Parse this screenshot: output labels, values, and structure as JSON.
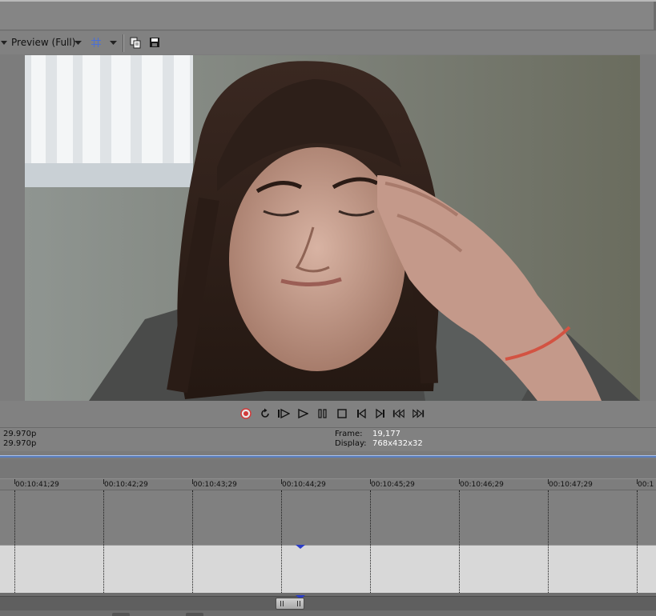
{
  "toolbar": {
    "preview_quality": "Preview (Full)",
    "icons": [
      "dropdown-caret",
      "grid-overlay-icon",
      "copy-snapshot-icon",
      "save-snapshot-icon"
    ]
  },
  "transport": {
    "buttons": [
      "record",
      "loop",
      "play-from-start",
      "play",
      "pause",
      "stop",
      "previous-frame",
      "next-frame",
      "go-to-start",
      "go-to-end"
    ]
  },
  "info": {
    "project_rate": "29.970p",
    "preview_rate": "29.970p",
    "frame_label": "Frame:",
    "frame_value": "19,177",
    "display_label": "Display:",
    "display_value": "768x432x32"
  },
  "timeline": {
    "ticks": [
      "00:10:41;29",
      "00:10:42;29",
      "00:10:43;29",
      "00:10:44;29",
      "00:10:45;29",
      "00:10:46;29",
      "00:10:47;29",
      "00:1"
    ]
  },
  "colors": {
    "accent_blue": "#5b7fbf",
    "record_red": "#d23a3a",
    "grid_icon_blue": "#4a6fd6",
    "playhead_blue": "#2a3cc8"
  }
}
